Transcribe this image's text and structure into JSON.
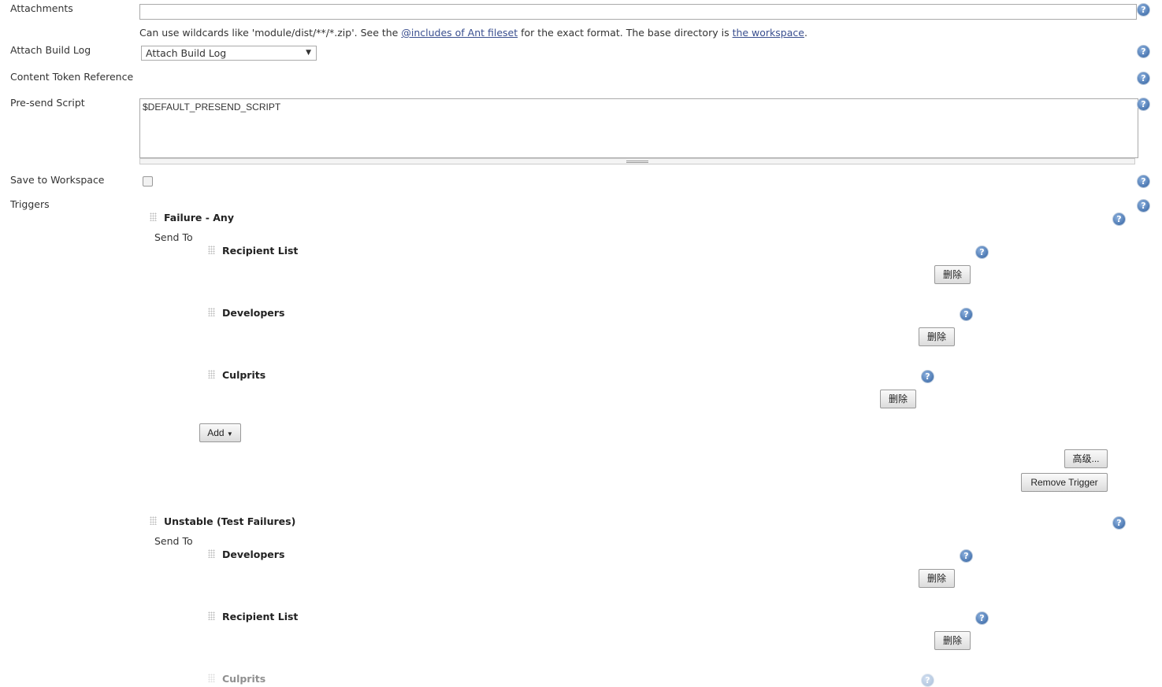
{
  "attachments": {
    "label": "Attachments",
    "value": "",
    "hint_pre": "Can use wildcards like 'module/dist/**/*.zip'. See the ",
    "hint_link1": "@includes of Ant fileset",
    "hint_mid": " for the exact format. The base directory is ",
    "hint_link2": "the workspace",
    "hint_end": "."
  },
  "attach_build_log": {
    "label": "Attach Build Log",
    "selected": "Attach Build Log"
  },
  "content_token": {
    "label": "Content Token Reference"
  },
  "presend": {
    "label": "Pre-send Script",
    "value": "$DEFAULT_PRESEND_SCRIPT"
  },
  "save_workspace": {
    "label": "Save to Workspace",
    "checked": false
  },
  "triggers": {
    "label": "Triggers",
    "send_to": "Send To",
    "add": "Add",
    "advanced": "高级...",
    "remove_trigger": "Remove Trigger",
    "delete": "删除",
    "items": [
      {
        "name": "Failure - Any",
        "recipients": [
          "Recipient List",
          "Developers",
          "Culprits"
        ]
      },
      {
        "name": "Unstable (Test Failures)",
        "recipients": [
          "Developers",
          "Recipient List",
          "Culprits"
        ]
      }
    ]
  },
  "colors": {
    "link": "#3a4f8f",
    "help": "#2f5f9e"
  }
}
